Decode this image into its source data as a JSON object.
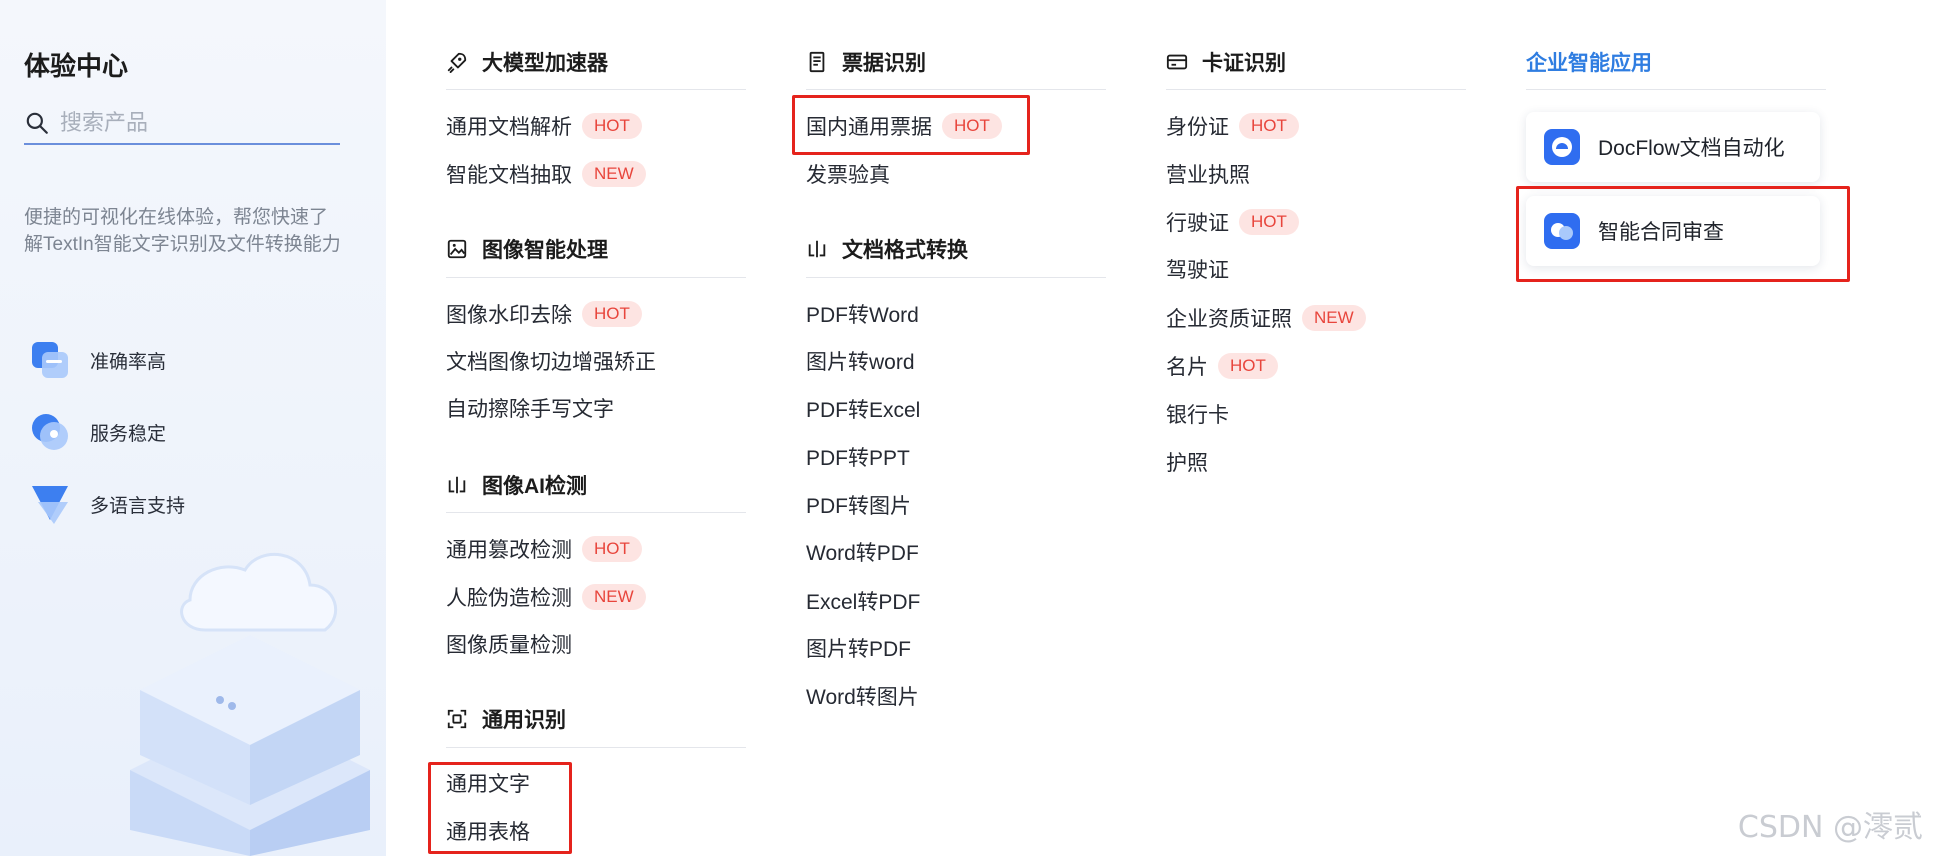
{
  "left": {
    "title": "体验中心",
    "search_placeholder": "搜索产品",
    "description": "便捷的可视化在线体验，帮您快速了解TextIn智能文字识别及文件转换能力",
    "features": [
      {
        "label": "准确率高",
        "icon": "accuracy-icon"
      },
      {
        "label": "服务稳定",
        "icon": "stability-icon"
      },
      {
        "label": "多语言支持",
        "icon": "multilanguage-icon"
      }
    ]
  },
  "col1": {
    "sections": [
      {
        "title": "大模型加速器",
        "icon": "rocket-icon",
        "items": [
          {
            "label": "通用文档解析",
            "badge": "HOT"
          },
          {
            "label": "智能文档抽取",
            "badge": "NEW"
          }
        ]
      },
      {
        "title": "图像智能处理",
        "icon": "image-icon",
        "items": [
          {
            "label": "图像水印去除",
            "badge": "HOT"
          },
          {
            "label": "文档图像切边增强矫正",
            "badge": ""
          },
          {
            "label": "自动擦除手写文字",
            "badge": ""
          }
        ]
      },
      {
        "title": "图像AI检测",
        "icon": "detect-icon",
        "items": [
          {
            "label": "通用篡改检测",
            "badge": "HOT"
          },
          {
            "label": "人脸伪造检测",
            "badge": "NEW"
          },
          {
            "label": "图像质量检测",
            "badge": ""
          }
        ]
      },
      {
        "title": "通用识别",
        "icon": "scan-icon",
        "items": [
          {
            "label": "通用文字",
            "badge": ""
          },
          {
            "label": "通用表格",
            "badge": ""
          }
        ]
      }
    ]
  },
  "col2": {
    "sections": [
      {
        "title": "票据识别",
        "icon": "receipt-icon",
        "items": [
          {
            "label": "国内通用票据",
            "badge": "HOT"
          },
          {
            "label": "发票验真",
            "badge": ""
          }
        ]
      },
      {
        "title": "文档格式转换",
        "icon": "convert-icon",
        "items": [
          {
            "label": "PDF转Word",
            "badge": ""
          },
          {
            "label": "图片转word",
            "badge": ""
          },
          {
            "label": "PDF转Excel",
            "badge": ""
          },
          {
            "label": "PDF转PPT",
            "badge": ""
          },
          {
            "label": "PDF转图片",
            "badge": ""
          },
          {
            "label": "Word转PDF",
            "badge": ""
          },
          {
            "label": "Excel转PDF",
            "badge": ""
          },
          {
            "label": "图片转PDF",
            "badge": ""
          },
          {
            "label": "Word转图片",
            "badge": ""
          }
        ]
      }
    ]
  },
  "col3": {
    "sections": [
      {
        "title": "卡证识别",
        "icon": "card-icon",
        "items": [
          {
            "label": "身份证",
            "badge": "HOT"
          },
          {
            "label": "营业执照",
            "badge": ""
          },
          {
            "label": "行驶证",
            "badge": "HOT"
          },
          {
            "label": "驾驶证",
            "badge": ""
          },
          {
            "label": "企业资质证照",
            "badge": "NEW"
          },
          {
            "label": "名片",
            "badge": "HOT"
          },
          {
            "label": "银行卡",
            "badge": ""
          },
          {
            "label": "护照",
            "badge": ""
          }
        ]
      }
    ]
  },
  "col4": {
    "title": "企业智能应用",
    "cards": [
      {
        "label": "DocFlow文档自动化",
        "icon": "docflow-icon"
      },
      {
        "label": "智能合同审查",
        "icon": "contract-review-icon"
      }
    ]
  },
  "colors": {
    "accent": "#2f7de1",
    "hot_badge_bg": "#fde4e2",
    "hot_badge_text": "#e8453c",
    "annotation_red": "#e5231c"
  },
  "watermark": "CSDN @澪贰"
}
